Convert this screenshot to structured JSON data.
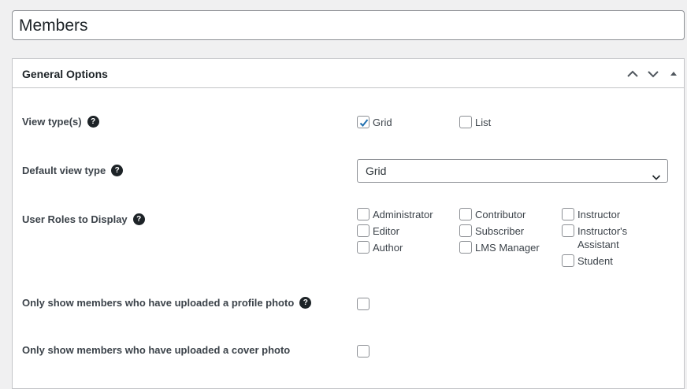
{
  "title_field": {
    "value": "Members"
  },
  "postbox": {
    "title": "General Options",
    "header_icons": [
      "chevron-up-icon",
      "chevron-down-icon",
      "triangle-up-icon"
    ]
  },
  "view_types": {
    "label": "View type(s)",
    "options": [
      {
        "label": "Grid",
        "checked": true
      },
      {
        "label": "List",
        "checked": false
      }
    ]
  },
  "default_view": {
    "label": "Default view type",
    "selected": "Grid"
  },
  "user_roles": {
    "label": "User Roles to Display",
    "options": [
      {
        "label": "Administrator",
        "checked": false
      },
      {
        "label": "Editor",
        "checked": false
      },
      {
        "label": "Author",
        "checked": false
      },
      {
        "label": "Contributor",
        "checked": false
      },
      {
        "label": "Subscriber",
        "checked": false
      },
      {
        "label": "LMS Manager",
        "checked": false
      },
      {
        "label": "Instructor",
        "checked": false
      },
      {
        "label": "Instructor's Assistant",
        "checked": false
      },
      {
        "label": "Student",
        "checked": false
      }
    ]
  },
  "profile_photo": {
    "label": "Only show members who have uploaded a profile photo",
    "checked": false
  },
  "cover_photo": {
    "label": "Only show members who have uploaded a cover photo",
    "checked": false
  },
  "colors": {
    "accent": "#2271b1",
    "border": "#8c8f94",
    "background": "#f0f0f1"
  }
}
